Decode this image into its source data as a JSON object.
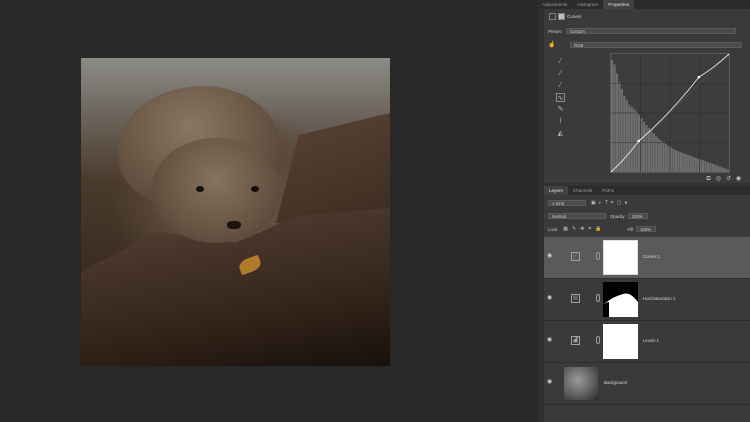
{
  "panels": {
    "top_tabs": [
      "Adjustments",
      "Histogram",
      "Properties"
    ],
    "properties": {
      "title": "Curves",
      "preset_label": "Preset:",
      "preset_value": "Custom",
      "channel": "RGB",
      "tools": [
        "hand-adjust",
        "eyedropper-black",
        "eyedropper-gray",
        "eyedropper-white",
        "curve-point",
        "pencil",
        "smooth",
        "clip-warning"
      ],
      "curve_points": [
        [
          0,
          0
        ],
        [
          60,
          67
        ],
        [
          190,
          205
        ],
        [
          255,
          255
        ]
      ],
      "histogram": [
        250,
        240,
        220,
        200,
        185,
        170,
        160,
        150,
        145,
        140,
        135,
        128,
        120,
        112,
        105,
        98,
        92,
        86,
        80,
        74,
        70,
        66,
        62,
        58,
        55,
        52,
        49,
        46,
        44,
        42,
        40,
        38,
        36,
        34,
        32,
        30,
        28,
        26,
        24,
        22,
        20,
        18,
        16,
        14,
        12,
        10,
        8,
        6
      ]
    },
    "layers_tabs": [
      "Layers",
      "Channels",
      "Paths"
    ],
    "layers": {
      "filter": "Kind",
      "blend_mode": "Normal",
      "opacity_label": "Opacity:",
      "opacity_value": "100%",
      "lock_label": "Lock:",
      "fill_label": "Fill:",
      "fill_value": "100%",
      "items": [
        {
          "name": "Curves 1",
          "type": "curves",
          "selected": true
        },
        {
          "name": "Hue/Saturation 1",
          "type": "hue",
          "selected": false
        },
        {
          "name": "Levels 1",
          "type": "levels",
          "selected": false
        },
        {
          "name": "Background",
          "type": "background",
          "selected": false
        }
      ]
    }
  }
}
